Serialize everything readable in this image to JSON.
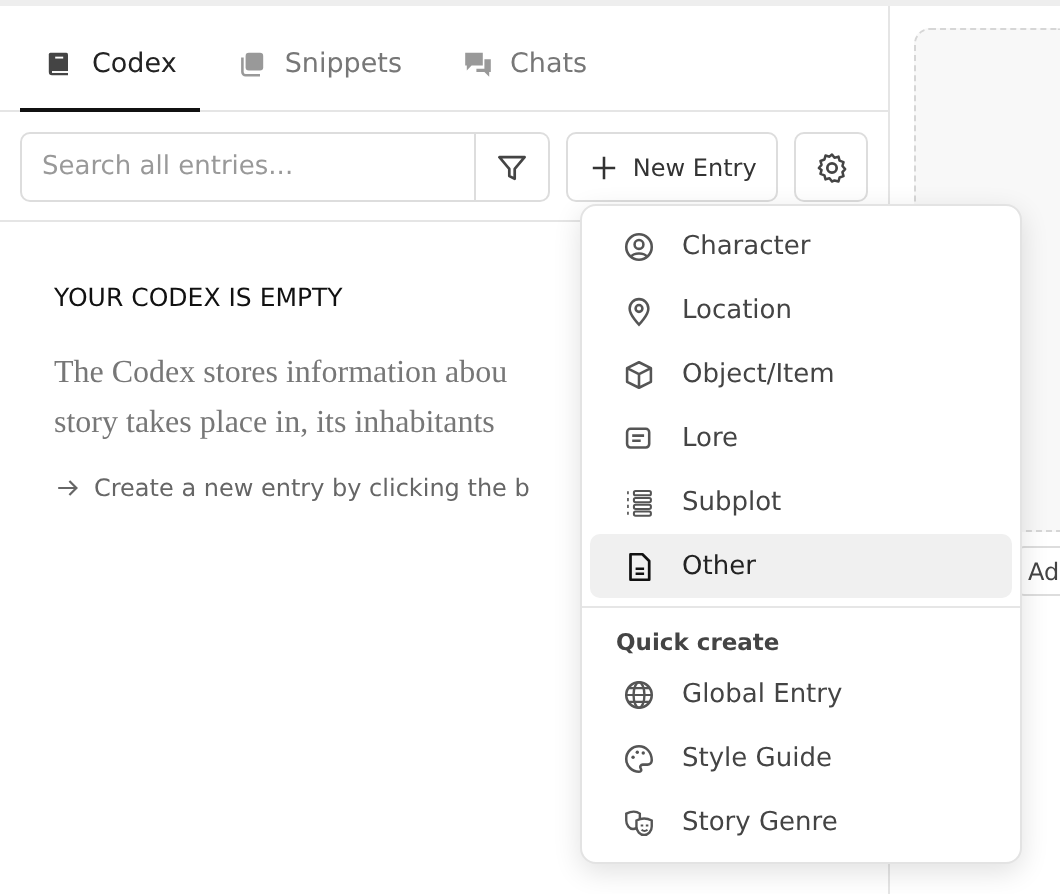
{
  "tabs": [
    {
      "label": "Codex",
      "selected": true
    },
    {
      "label": "Snippets",
      "selected": false
    },
    {
      "label": "Chats",
      "selected": false
    }
  ],
  "search": {
    "placeholder": "Search all entries..."
  },
  "new_entry_button": "New Entry",
  "empty_state": {
    "title": "YOUR CODEX IS EMPTY",
    "description_lines": [
      "The Codex stores information abou",
      "story takes place in, its inhabitants"
    ],
    "hint": "Create a new entry by clicking the b"
  },
  "background_button": "Ad",
  "menu": {
    "items": [
      {
        "label": "Character",
        "selected": false
      },
      {
        "label": "Location",
        "selected": false
      },
      {
        "label": "Object/Item",
        "selected": false
      },
      {
        "label": "Lore",
        "selected": false
      },
      {
        "label": "Subplot",
        "selected": false
      },
      {
        "label": "Other",
        "selected": true
      }
    ],
    "section_title": "Quick create",
    "quick_items": [
      {
        "label": "Global Entry"
      },
      {
        "label": "Style Guide"
      },
      {
        "label": "Story Genre"
      }
    ]
  }
}
